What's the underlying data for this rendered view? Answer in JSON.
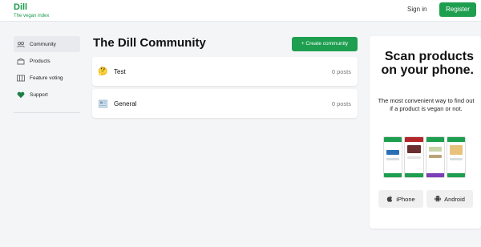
{
  "header": {
    "brand_name": "Dill",
    "brand_tagline": "The vegan index",
    "signin_label": "Sign in",
    "register_label": "Register"
  },
  "sidebar": {
    "items": [
      {
        "label": "Community",
        "icon": "community-icon",
        "active": true
      },
      {
        "label": "Products",
        "icon": "products-icon",
        "active": false
      },
      {
        "label": "Feature voting",
        "icon": "feature-voting-icon",
        "active": false
      },
      {
        "label": "Support",
        "icon": "heart-icon",
        "active": false
      }
    ]
  },
  "main": {
    "title": "The Dill Community",
    "create_label": "+ Create community",
    "communities": [
      {
        "name": "Test",
        "posts": "0 posts",
        "icon": "thinking-face-icon"
      },
      {
        "name": "General",
        "posts": "0 posts",
        "icon": "newspaper-icon"
      }
    ]
  },
  "promo": {
    "title": "Scan products on your phone.",
    "description": "The most convenient way to find out if a product is vegan or not.",
    "iphone_label": "iPhone",
    "android_label": "Android"
  },
  "colors": {
    "brand_green": "#1e9e4f",
    "background": "#f4f5f7"
  }
}
